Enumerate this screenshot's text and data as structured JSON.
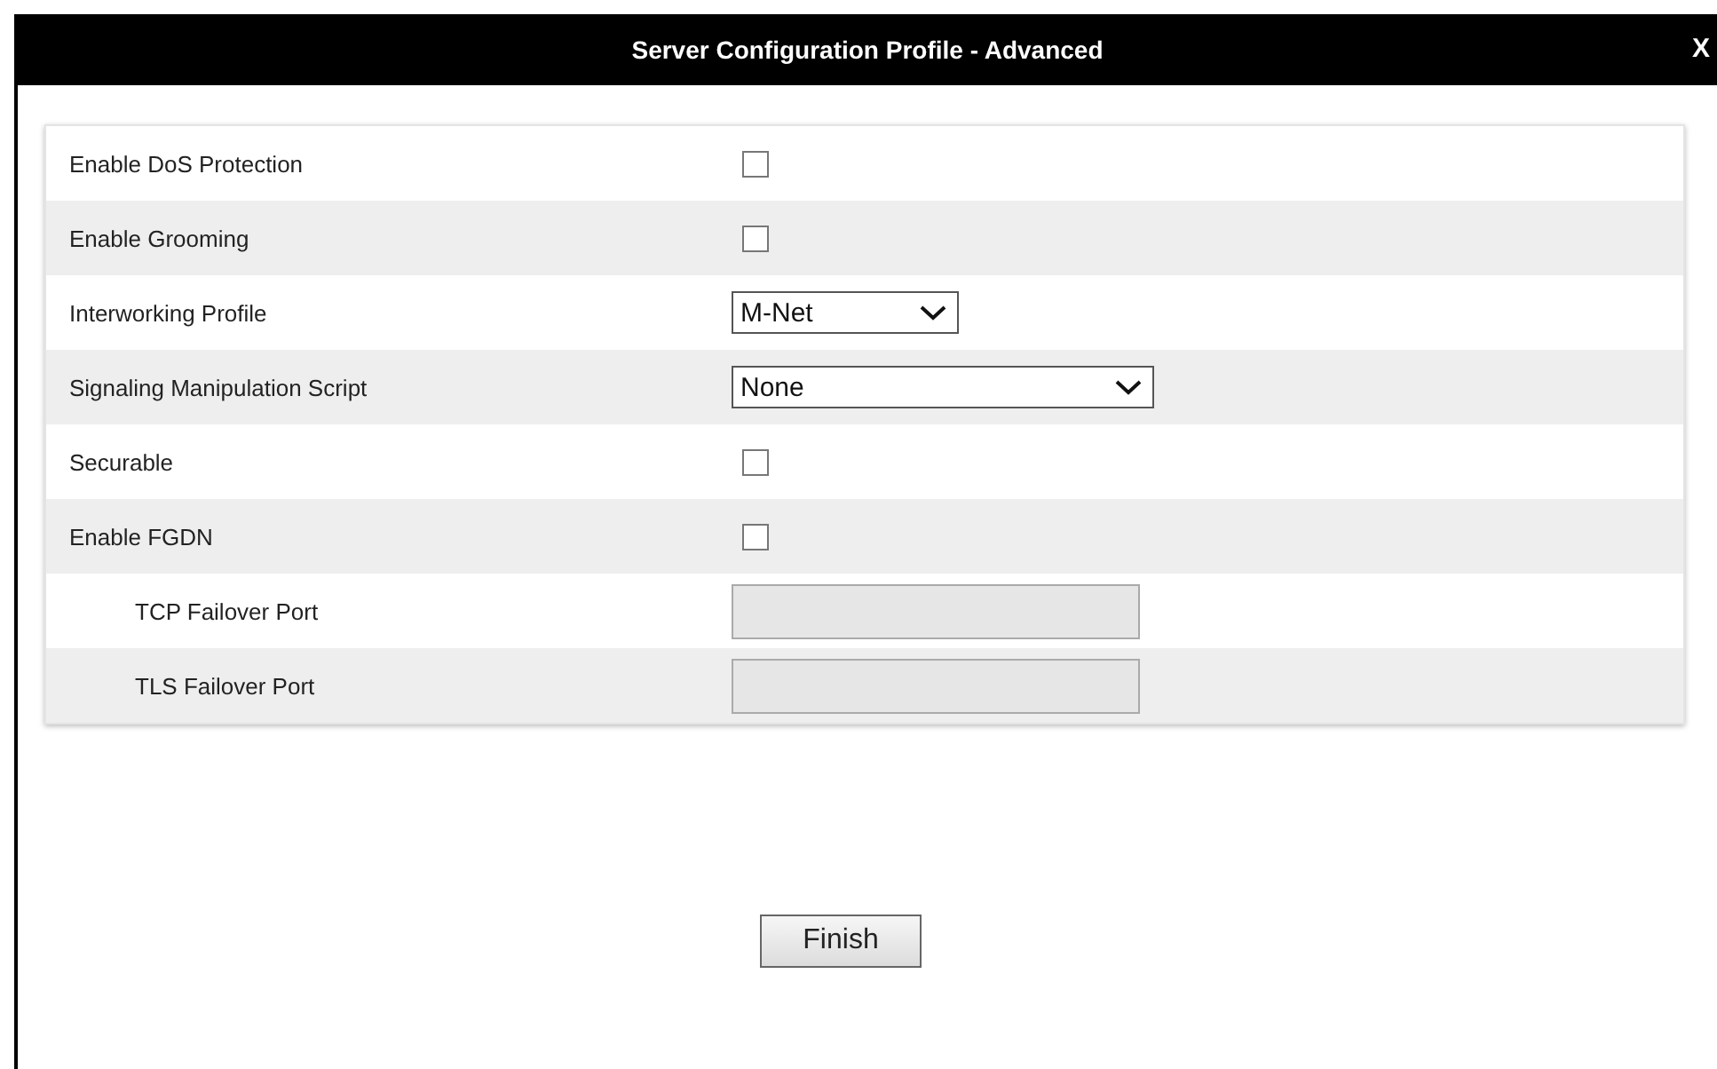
{
  "dialog": {
    "title": "Server Configuration Profile - Advanced",
    "close": "X"
  },
  "rows": [
    {
      "kind": "checkbox",
      "label": "Enable DoS Protection",
      "checked": false
    },
    {
      "kind": "checkbox",
      "label": "Enable Grooming",
      "checked": false
    },
    {
      "kind": "select",
      "label": "Interworking Profile",
      "value": "M-Net"
    },
    {
      "kind": "select",
      "label": "Signaling Manipulation Script",
      "value": "None"
    },
    {
      "kind": "checkbox",
      "label": "Securable",
      "checked": false
    },
    {
      "kind": "checkbox",
      "label": "Enable FGDN",
      "checked": false,
      "children": [
        {
          "kind": "input",
          "label": "TCP Failover Port",
          "disabled": true
        },
        {
          "kind": "input",
          "label": "TLS Failover Port",
          "disabled": true
        }
      ]
    }
  ],
  "buttons": [
    "Finish"
  ]
}
